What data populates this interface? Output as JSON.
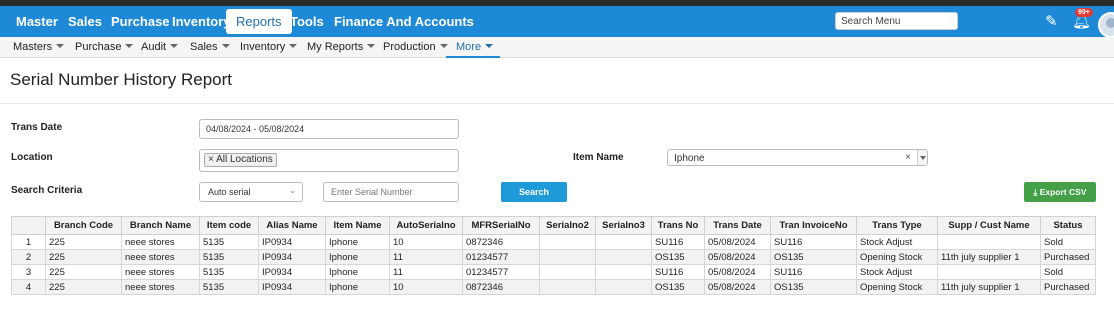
{
  "main_nav": {
    "items": [
      "Master",
      "Sales",
      "Purchase",
      "Inventory",
      "Reports",
      "Tools",
      "Finance And Accounts"
    ],
    "active": "Reports",
    "search_placeholder": "Search Menu",
    "notification_badge": "99+"
  },
  "sub_nav": {
    "items": [
      "Masters",
      "Purchase",
      "Audit",
      "Sales",
      "Inventory",
      "My Reports",
      "Production",
      "More"
    ],
    "active": "More"
  },
  "page_title": "Serial Number History Report",
  "filters": {
    "trans_date_label": "Trans Date",
    "trans_date_value": "04/08/2024 - 05/08/2024",
    "location_label": "Location",
    "location_tag": "All Locations",
    "item_name_label": "Item Name",
    "item_name_value": "Iphone",
    "search_criteria_label": "Search Criteria",
    "search_criteria_value": "Auto serial",
    "serial_placeholder": "Enter Serial Number",
    "search_button": "Search",
    "export_button": "Export CSV"
  },
  "table": {
    "headers": [
      "",
      "Branch Code",
      "Branch Name",
      "Item code",
      "Alias Name",
      "Item Name",
      "AutoSerialno",
      "MFRSerialNo",
      "Serialno2",
      "Serialno3",
      "Trans No",
      "Trans Date",
      "Tran InvoiceNo",
      "Trans Type",
      "Supp / Cust Name",
      "Status"
    ],
    "rows": [
      [
        "1",
        "225",
        "neee stores",
        "5135",
        "IP0934",
        "Iphone",
        "10",
        "0872346",
        "",
        "",
        "SU116",
        "05/08/2024",
        "SU116",
        "Stock Adjust",
        "",
        "Sold"
      ],
      [
        "2",
        "225",
        "neee stores",
        "5135",
        "IP0934",
        "Iphone",
        "11",
        "01234577",
        "",
        "",
        "OS135",
        "05/08/2024",
        "OS135",
        "Opening Stock",
        "11th july supplier 1",
        "Purchased"
      ],
      [
        "3",
        "225",
        "neee stores",
        "5135",
        "IP0934",
        "Iphone",
        "11",
        "01234577",
        "",
        "",
        "SU116",
        "05/08/2024",
        "SU116",
        "Stock Adjust",
        "",
        "Sold"
      ],
      [
        "4",
        "225",
        "neee stores",
        "5135",
        "IP0934",
        "Iphone",
        "10",
        "0872346",
        "",
        "",
        "OS135",
        "05/08/2024",
        "OS135",
        "Opening Stock",
        "11th july supplier 1",
        "Purchased"
      ]
    ]
  },
  "icons": {
    "pen": "pen-icon",
    "bell": "bell-icon",
    "avatar": "user-avatar"
  },
  "colors": {
    "nav_bg": "#1e8ad7",
    "search_button": "#1e9ad8",
    "export_button": "#43a047",
    "badge": "#e53935"
  }
}
